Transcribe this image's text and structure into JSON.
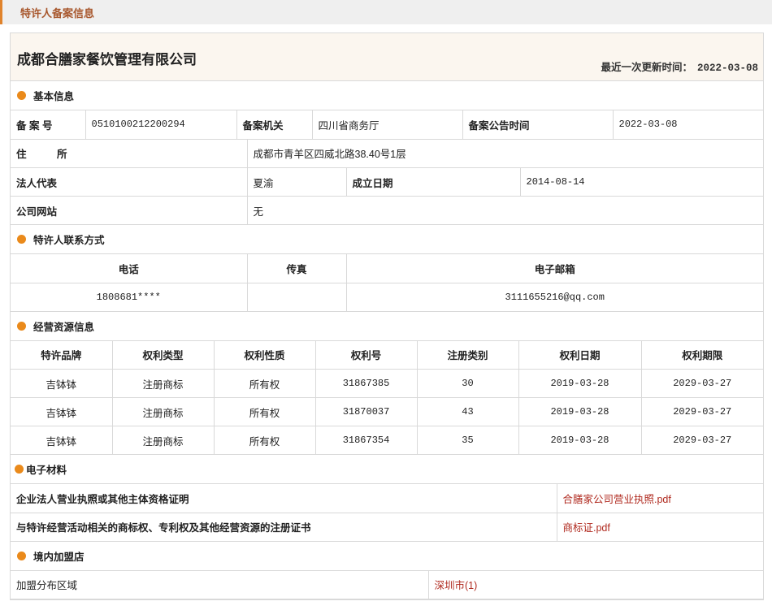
{
  "header": {
    "title": "特许人备案信息"
  },
  "company": {
    "name": "成都合膳家餐饮管理有限公司",
    "update_label": "最近一次更新时间：",
    "update_value": "2022-03-08"
  },
  "basic": {
    "title": "基本信息",
    "reg_no_label": "备 案 号",
    "reg_no": "0510100212200294",
    "authority_label": "备案机关",
    "authority": "四川省商务厅",
    "announce_label": "备案公告时间",
    "announce": "2022-03-08",
    "address_label": "住　　　所",
    "address": "成都市青羊区四威北路38.40号1层",
    "rep_label": "法人代表",
    "rep": "夏渝",
    "est_label": "成立日期",
    "est": "2014-08-14",
    "site_label": "公司网站",
    "site": "无"
  },
  "contact": {
    "title": "特许人联系方式",
    "phone_label": "电话",
    "fax_label": "传真",
    "email_label": "电子邮箱",
    "phone": "1808681****",
    "fax": "",
    "email": "3111655216@qq.com"
  },
  "resources": {
    "title": "经营资源信息",
    "headers": [
      "特许品牌",
      "权利类型",
      "权利性质",
      "权利号",
      "注册类别",
      "权利日期",
      "权利期限"
    ],
    "rows": [
      [
        "吉钵钵",
        "注册商标",
        "所有权",
        "31867385",
        "30",
        "2019-03-28",
        "2029-03-27"
      ],
      [
        "吉钵钵",
        "注册商标",
        "所有权",
        "31870037",
        "43",
        "2019-03-28",
        "2029-03-27"
      ],
      [
        "吉钵钵",
        "注册商标",
        "所有权",
        "31867354",
        "35",
        "2019-03-28",
        "2029-03-27"
      ]
    ]
  },
  "materials": {
    "title": "电子材料",
    "items": [
      {
        "label": "企业法人营业执照或其他主体资格证明",
        "file": "合膳家公司营业执照.pdf"
      },
      {
        "label": "与特许经营活动相关的商标权、专利权及其他经营资源的注册证书",
        "file": "商标证.pdf"
      }
    ]
  },
  "stores": {
    "title": "境内加盟店",
    "area_label": "加盟分布区域",
    "area_value": "深圳市(1)"
  },
  "colors": {
    "accent": "#ea8a1b",
    "header_text": "#a8582e",
    "link": "#b02a1f"
  }
}
